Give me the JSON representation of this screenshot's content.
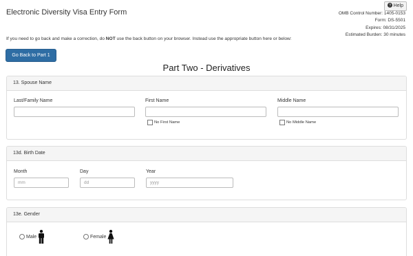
{
  "header": {
    "title": "Electronic Diversity Visa Entry Form",
    "help_label": "Help",
    "omb_lines": [
      "OMB Control Number: 1405-0153",
      "Form: DS-5501",
      "Expires: 08/31/2025",
      "Estimated Burden: 30 minutes"
    ]
  },
  "notice": {
    "prefix": "If you need to go back and make a correction, do ",
    "emphasis": "NOT",
    "suffix": " use the back button on your browser. Instead use the appropriate button here or below:"
  },
  "back_button_label": "Go Back to Part 1",
  "part_title": "Part Two - Derivatives",
  "spouse_name": {
    "heading": "13. Spouse Name",
    "last_label": "Last/Family Name",
    "last_value": "",
    "first_label": "First Name",
    "first_value": "",
    "middle_label": "Middle Name",
    "middle_value": "",
    "no_first_label": "No First Name",
    "no_middle_label": "No Middle Name"
  },
  "birth_date": {
    "heading": "13d. Birth Date",
    "month_label": "Month",
    "month_placeholder": "mm",
    "day_label": "Day",
    "day_placeholder": "dd",
    "year_label": "Year",
    "year_placeholder": "yyyy"
  },
  "gender": {
    "heading": "13e. Gender",
    "male_label": "Male",
    "female_label": "Female"
  },
  "icons": {
    "help": "question-circle-icon",
    "male": "male-person-icon",
    "female": "female-person-icon"
  }
}
